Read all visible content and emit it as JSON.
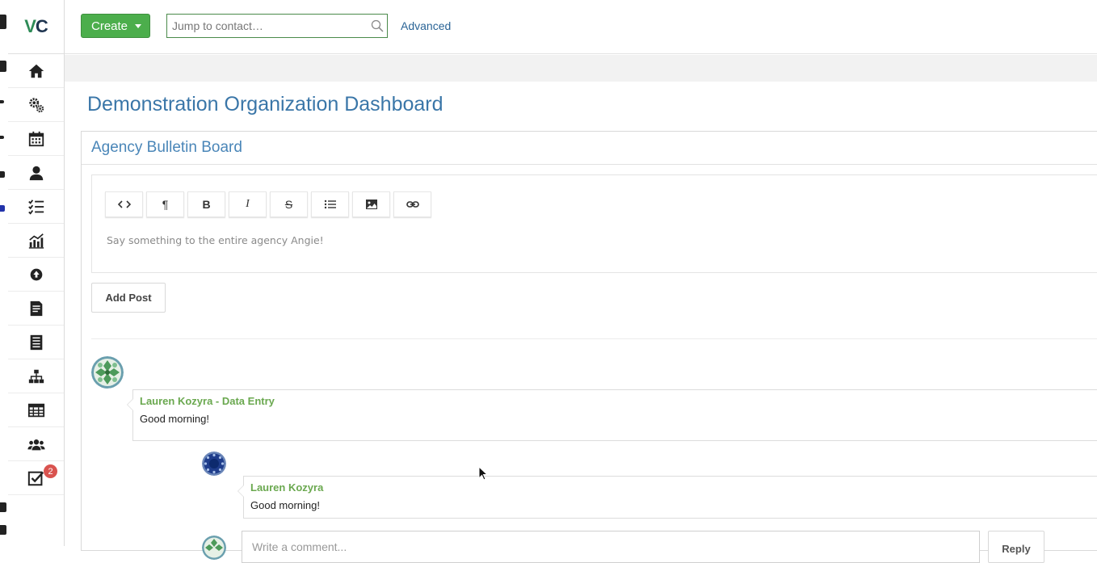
{
  "app": {
    "logo_text_left": "V",
    "logo_text_right": "C"
  },
  "topbar": {
    "create_label": "Create",
    "search_placeholder": "Jump to contact…",
    "advanced_label": "Advanced"
  },
  "sidebar": {
    "items": [
      {
        "icon": "home-icon"
      },
      {
        "icon": "gears-icon"
      },
      {
        "icon": "calendar-icon"
      },
      {
        "icon": "user-icon"
      },
      {
        "icon": "checklist-icon"
      },
      {
        "icon": "bar-chart-icon"
      },
      {
        "icon": "upload-icon"
      },
      {
        "icon": "document-icon"
      },
      {
        "icon": "report-icon"
      },
      {
        "icon": "org-chart-icon"
      },
      {
        "icon": "table-icon"
      },
      {
        "icon": "group-icon"
      },
      {
        "icon": "tasks-icon",
        "badge": "2"
      }
    ]
  },
  "page": {
    "title": "Demonstration Organization Dashboard"
  },
  "bulletin": {
    "title": "Agency Bulletin Board",
    "toolbar": [
      {
        "name": "code-view",
        "label": "<>"
      },
      {
        "name": "paragraph",
        "label": "¶"
      },
      {
        "name": "bold",
        "label": "B"
      },
      {
        "name": "italic",
        "label": "I"
      },
      {
        "name": "strikethrough",
        "label": "S"
      },
      {
        "name": "list",
        "label": ""
      },
      {
        "name": "image",
        "label": ""
      },
      {
        "name": "link",
        "label": ""
      }
    ],
    "editor_placeholder": "Say something to the entire agency Angie!",
    "add_post_label": "Add Post"
  },
  "posts": [
    {
      "author": "Lauren Kozyra - Data Entry",
      "text": "Good morning!"
    },
    {
      "author": "Lauren Kozyra",
      "text": "Good morning!"
    }
  ],
  "comment": {
    "placeholder": "Write a comment...",
    "reply_label": "Reply"
  },
  "colors": {
    "accent": "#3a76a8",
    "create_green": "#4cae4c",
    "author_green": "#6aa84f",
    "badge_red": "#d9534f",
    "active_marker": "#1a6fb5"
  }
}
